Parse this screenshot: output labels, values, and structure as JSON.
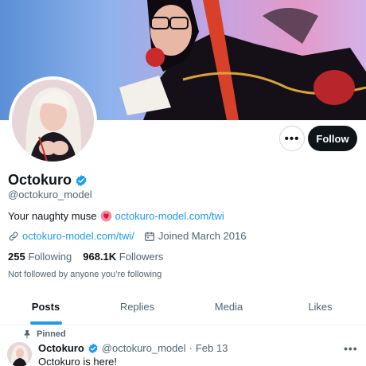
{
  "profile": {
    "display_name": "Octokuro",
    "handle": "@octokuro_model",
    "bio_text": "Your naughty muse",
    "bio_link": "octokuro-model.com/twi",
    "website": "octokuro-model.com/twi/",
    "joined": "Joined March 2016",
    "following_count": "255",
    "following_label": "Following",
    "followers_count": "968.1K",
    "followers_label": "Followers",
    "followed_note": "Not followed by anyone you’re following"
  },
  "actions": {
    "more_label": "•••",
    "follow_label": "Follow"
  },
  "tabs": [
    {
      "label": "Posts",
      "active": true
    },
    {
      "label": "Replies",
      "active": false
    },
    {
      "label": "Media",
      "active": false
    },
    {
      "label": "Likes",
      "active": false
    }
  ],
  "pinned_tweet": {
    "pinned_label": "Pinned",
    "author": "Octokuro",
    "handle": "@octokuro_model",
    "separator": "·",
    "date": "Feb 13",
    "text": "Octokuro is here!",
    "more_label": "•••"
  },
  "icons": {
    "verified": "verified-badge-icon",
    "link": "link-icon",
    "calendar": "calendar-icon",
    "pin": "pin-icon",
    "emoji": "heart-emoji-icon"
  },
  "colors": {
    "accent": "#1d9bf0",
    "text": "#0f1419",
    "muted": "#536471",
    "follow_button": "#0f1419"
  }
}
